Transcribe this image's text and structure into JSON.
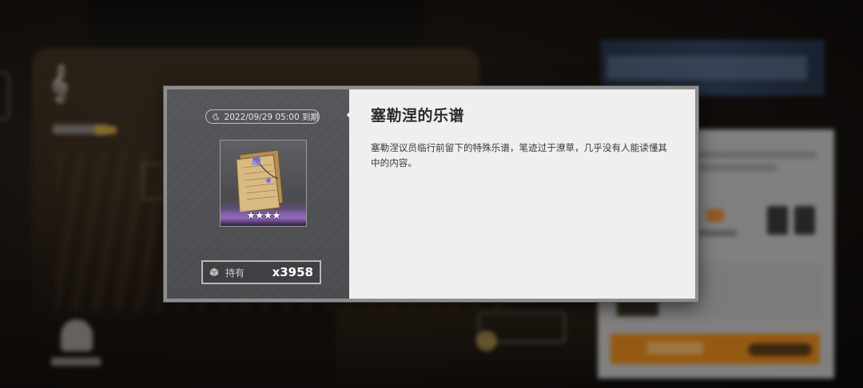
{
  "background": {
    "description_hidden": true
  },
  "item": {
    "expire_text": "2022/09/29 05:00 到期",
    "rarity_stars": 4,
    "stars_text": "★★★★",
    "owned_label": "持有",
    "owned_count": "x3958",
    "name": "塞勒涅的乐谱",
    "description": "塞勒涅议员临行前留下的特殊乐谱，笔迹过于潦草，几乎没有人能读懂其中的内容。"
  },
  "icons": {
    "expire": "moon-icon",
    "owned": "cube-icon",
    "item_art": "sheet-music-icon"
  },
  "colors": {
    "panel_left": "#4b4c4f",
    "panel_right": "#efefef",
    "border": "#8e8e8e",
    "rarity_glow": "#aa78dc"
  }
}
